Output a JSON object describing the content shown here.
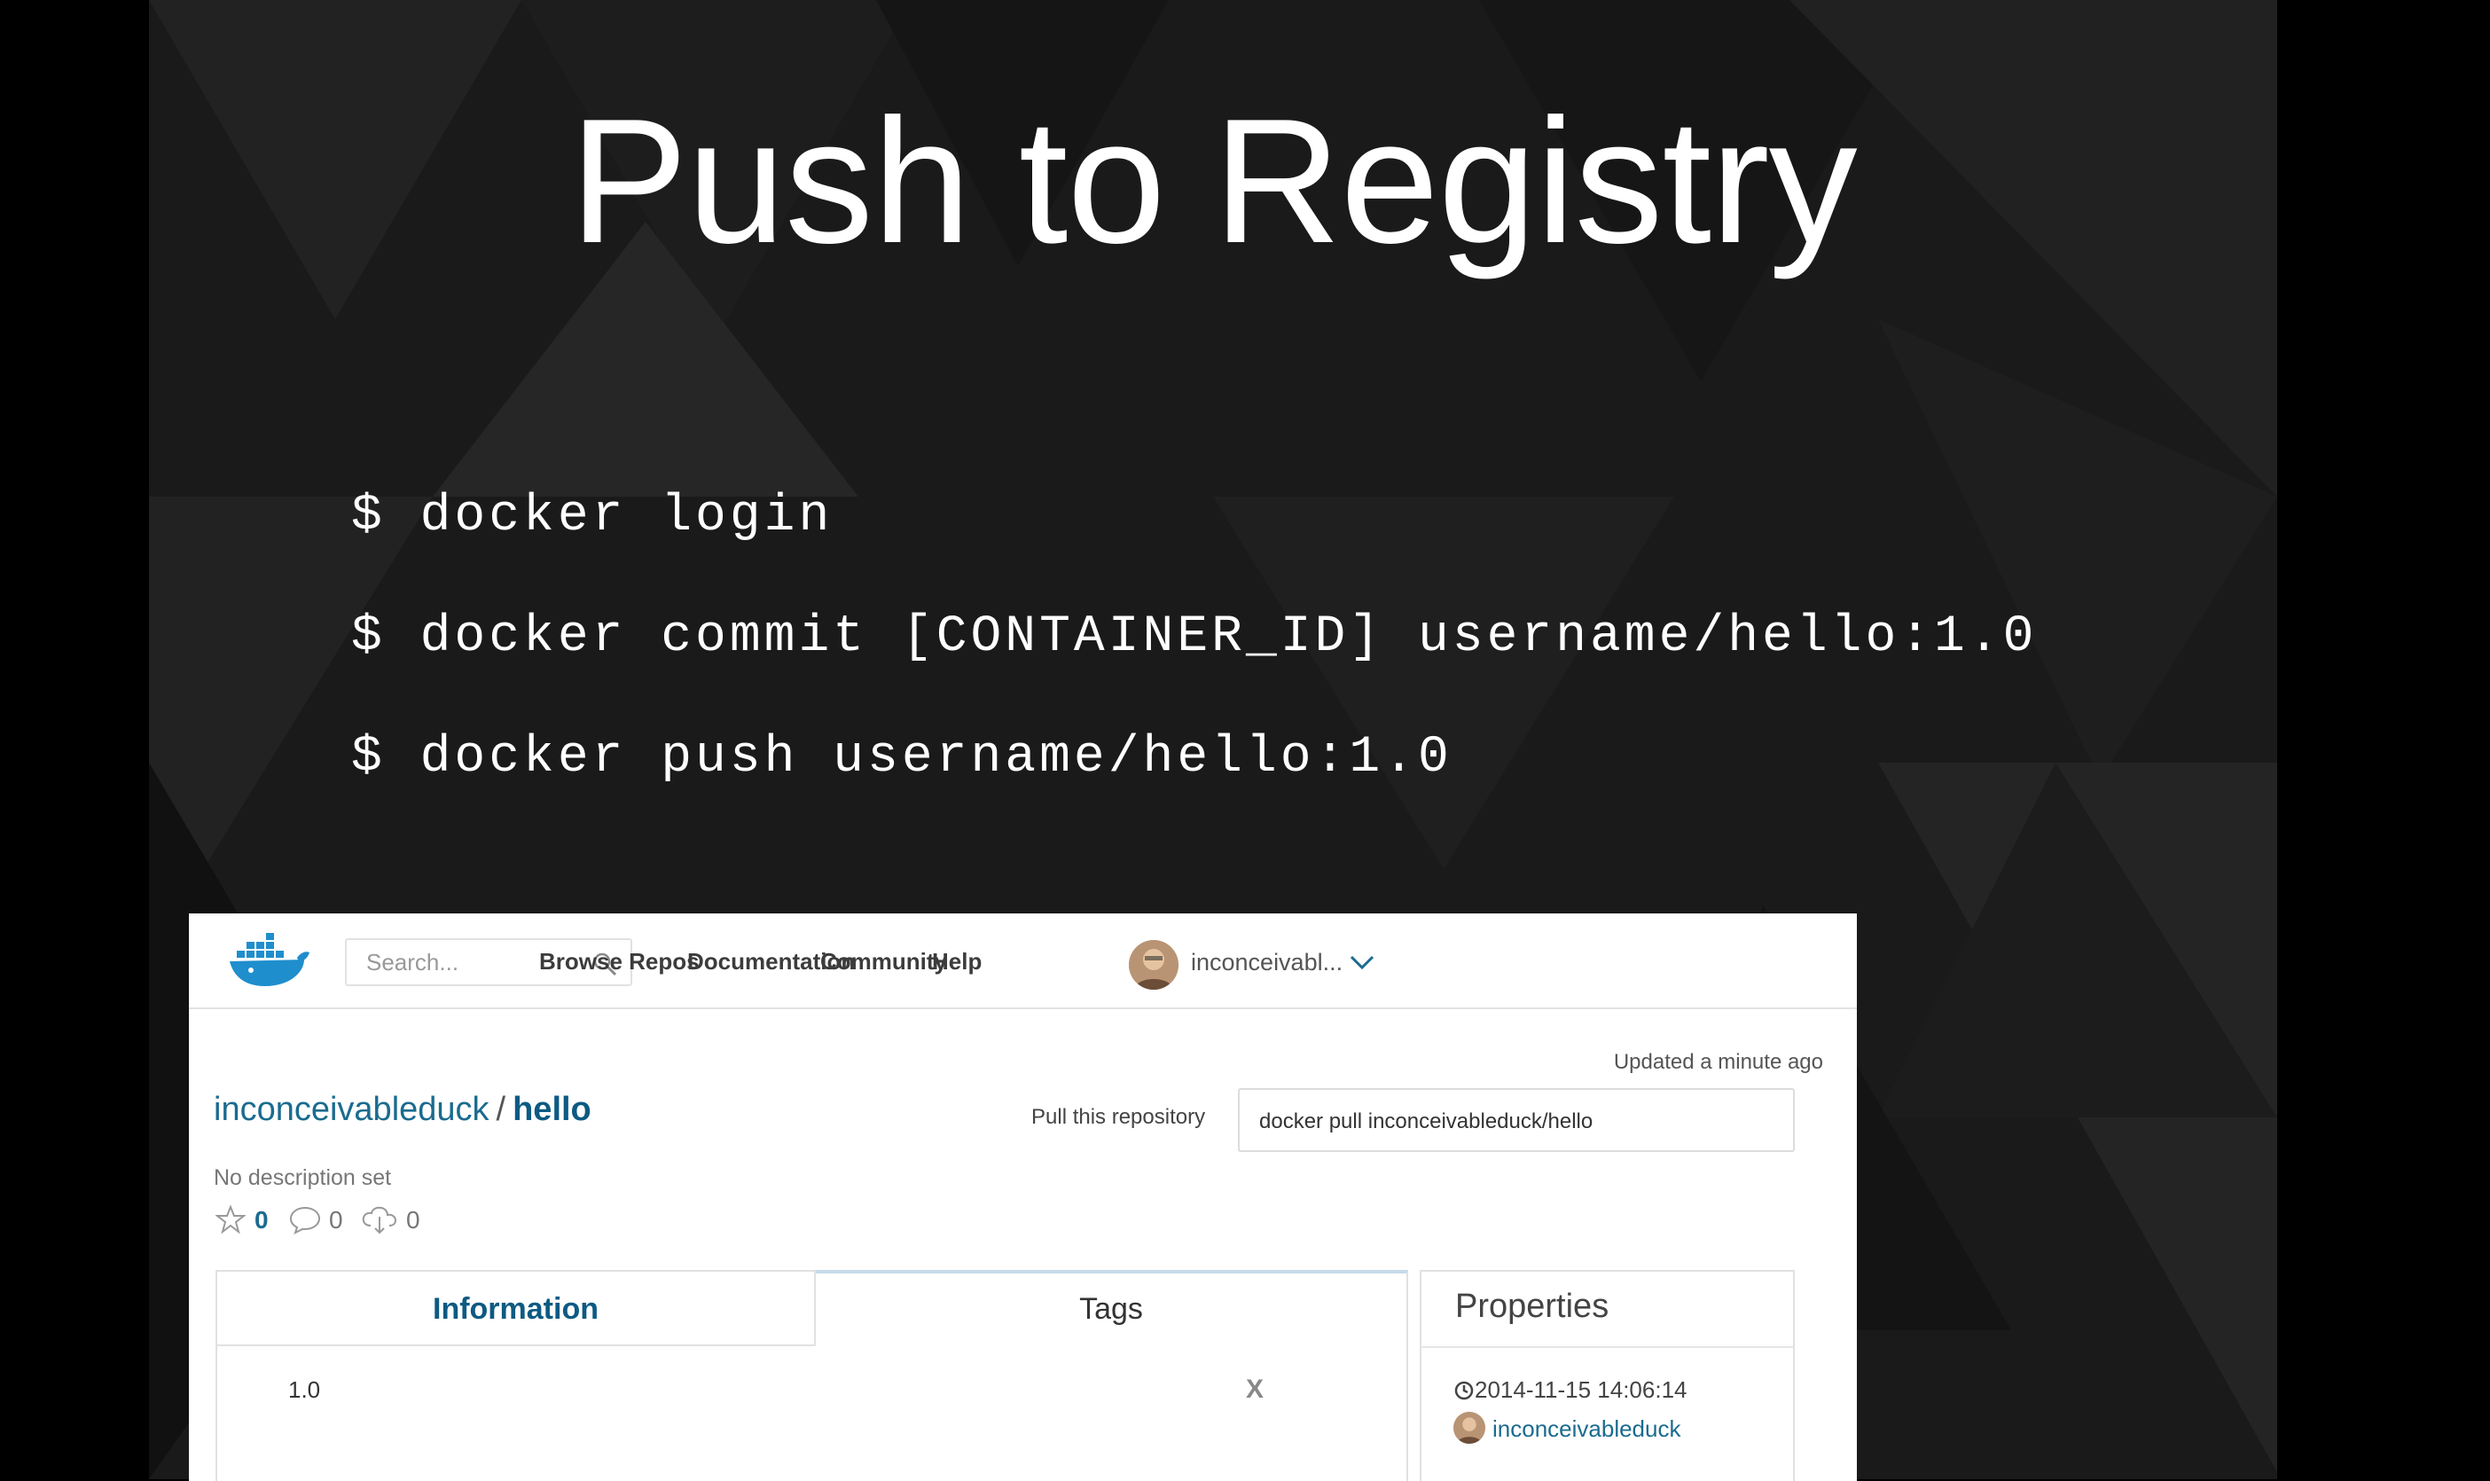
{
  "slide": {
    "title": "Push to Registry",
    "commands": [
      "$ docker login",
      "$ docker commit [CONTAINER_ID] username/hello:1.0",
      "$ docker push username/hello:1.0"
    ]
  },
  "hub": {
    "search_placeholder": "Search...",
    "nav": [
      "Browse Repos",
      "Documentation",
      "Community",
      "Help"
    ],
    "user": "inconceivabl...",
    "updated": "Updated a minute ago",
    "repo_owner": "inconceivableduck",
    "repo_sep": "/",
    "repo_name": "hello",
    "pull_label": "Pull this repository",
    "pull_command": "docker pull inconceivableduck/hello",
    "description": "No description set",
    "stars": "0",
    "comments": "0",
    "downloads": "0",
    "tabs": {
      "information": "Information",
      "tags": "Tags"
    },
    "tag_rows": [
      {
        "tag": "1.0",
        "remove": "X"
      }
    ],
    "properties": {
      "title": "Properties",
      "date": "2014-11-15 14:06:14",
      "owner": "inconceivableduck"
    }
  },
  "colors": {
    "link": "#1b6b8f",
    "slide_bg": "#1a1a1a"
  }
}
